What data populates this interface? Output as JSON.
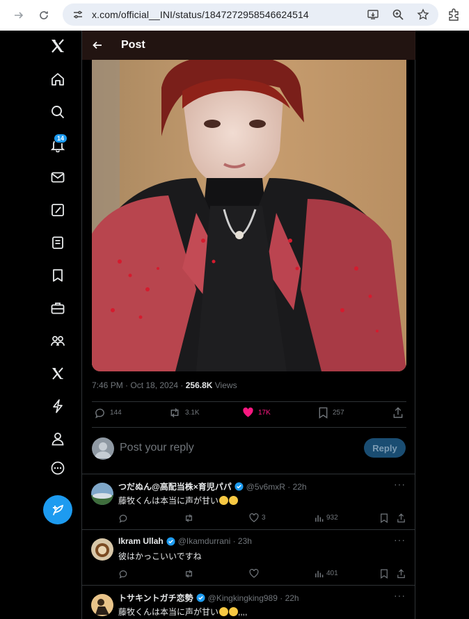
{
  "browser": {
    "url": "x.com/official__INI/status/1847272958546624514"
  },
  "nav": {
    "notification_count": "14"
  },
  "header": {
    "title": "Post"
  },
  "post": {
    "timestamp": "7:46 PM · Oct 18, 2024 · ",
    "views_count": "256.8K",
    "views_label": " Views",
    "replies": "144",
    "reposts": "3.1K",
    "likes": "17K",
    "bookmarks": "257",
    "like_color": "#f91880"
  },
  "composer": {
    "placeholder": "Post your reply",
    "reply_button": "Reply"
  },
  "replies": [
    {
      "name": "つだぬん@高配当株×育児パパ",
      "handle": "@5v6mxR · 22h",
      "text": "藤牧くんは本当に声が甘い",
      "likes": "3",
      "views": "932"
    },
    {
      "name": "Ikram Ullah",
      "handle": "@Ikamdurrani · 23h",
      "text": "彼はかっこいいですね",
      "likes": "",
      "views": "401"
    },
    {
      "name": "トサキントガチ恋勢",
      "handle": "@Kingkingking989 · 22h",
      "text": "藤牧くんは本当に声が甘い",
      "suffix": ",,,,",
      "likes": "",
      "views": ""
    }
  ]
}
